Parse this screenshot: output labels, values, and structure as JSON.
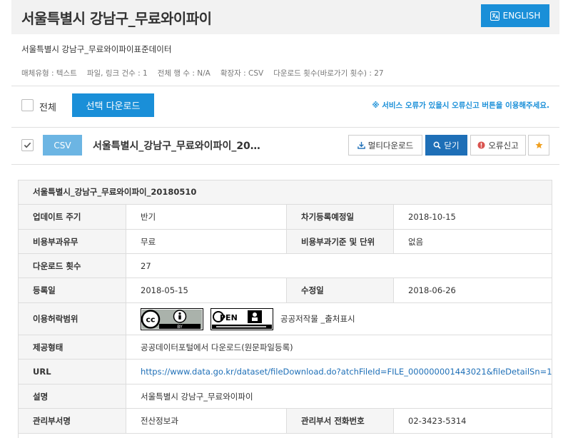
{
  "header": {
    "title": "서울특별시 강남구_무료와이파이",
    "english_label": "ENGLISH"
  },
  "subtitle": "서울특별시 강남구_무료와이파이표준데이터",
  "meta": {
    "media_type": "매체유형 : 텍스트",
    "file_count": "파일, 링크 건수 : 1",
    "row_count": "전체 행 수 : N/A",
    "extension": "확장자 : CSV",
    "download_count": "다운로드 횟수(바로가기 횟수) : 27"
  },
  "toolbar": {
    "select_all_label": "전체",
    "select_download_label": "선택 다운로드",
    "notice": "※ 서비스 오류가 있을시 오류신고 버튼을 이용해주세요."
  },
  "file": {
    "format": "CSV",
    "name": "서울특별시_강남구_무료와이파이_20…",
    "multi_download_label": "멀티다운로드",
    "close_label": "닫기",
    "report_label": "오류신고"
  },
  "detail": {
    "heading": "서울특별시_강남구_무료와이파이_20180510",
    "rows": [
      {
        "label": "업데이트 주기",
        "value": "반기",
        "label2": "차기등록예정일",
        "value2": "2018-10-15"
      },
      {
        "label": "비용부과유무",
        "value": "무료",
        "label2": "비용부과기준 및 단위",
        "value2": "없음"
      },
      {
        "label": "다운로드 횟수",
        "value": "27"
      },
      {
        "label": "등록일",
        "value": "2018-05-15",
        "label2": "수정일",
        "value2": "2018-06-26"
      },
      {
        "label": "이용허락범위",
        "value": "공공저작물 _출처표시"
      },
      {
        "label": "제공형태",
        "value": "공공데이터포털에서 다운로드(원문파일등록)"
      },
      {
        "label": "URL",
        "value": "https://www.data.go.kr/dataset/fileDownload.do?atchFileId=FILE_000000001443021&fileDetailSn=1"
      },
      {
        "label": "설명",
        "value": "서울특별시 강남구_무료와이파이"
      },
      {
        "label": "관리부서명",
        "value": "전산정보과",
        "label2": "관리부서 전화번호",
        "value2": "02-3423-5314"
      }
    ]
  },
  "colors": {
    "primary": "#1a8fd8",
    "close_button": "#1e6fb7",
    "csv_badge": "#6cb5e3",
    "star": "#f0a020",
    "report_icon": "#d9534f"
  },
  "icons": [
    "translate-icon",
    "checkbox-icon",
    "download-icon",
    "search-icon",
    "alert-icon",
    "star-icon",
    "cc-by-license-icon",
    "kogl-open-license-icon"
  ]
}
